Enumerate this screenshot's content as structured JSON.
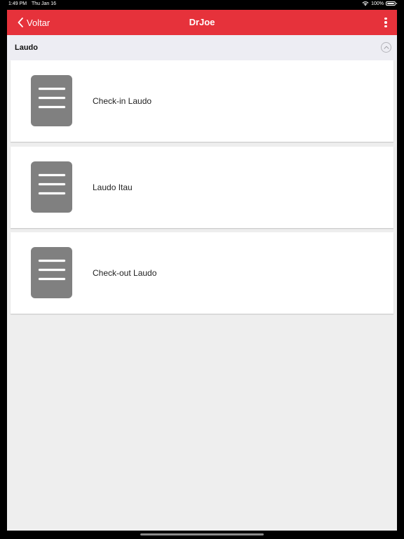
{
  "status_bar": {
    "time": "1:49 PM",
    "date": "Thu Jan 16",
    "battery": "100%"
  },
  "header": {
    "back_label": "Voltar",
    "title": "DrJoe",
    "background": "#e6323b"
  },
  "section": {
    "title": "Laudo"
  },
  "items": [
    {
      "label": "Check-in Laudo",
      "icon": "document-icon"
    },
    {
      "label": "Laudo Itau",
      "icon": "document-icon"
    },
    {
      "label": "Check-out Laudo",
      "icon": "document-icon"
    }
  ]
}
